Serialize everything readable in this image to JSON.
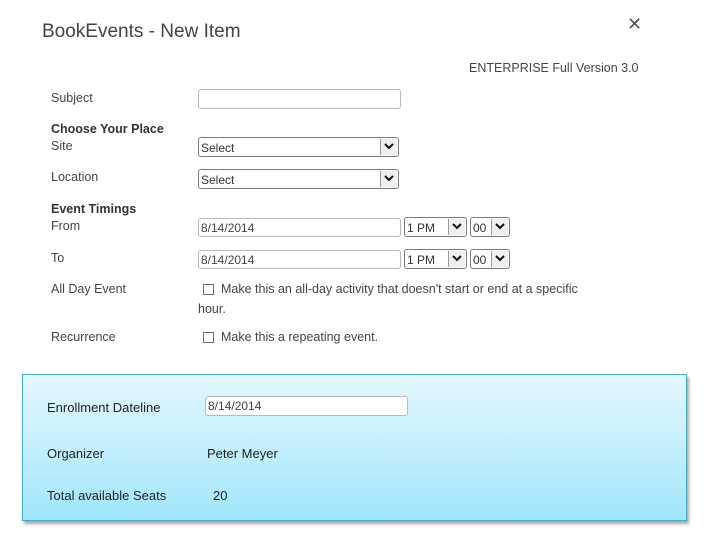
{
  "dialog": {
    "title": "BookEvents - New Item",
    "close_icon": "close-icon",
    "version_label": "ENTERPRISE Full Version 3.0"
  },
  "form": {
    "subject": {
      "label": "Subject",
      "value": ""
    },
    "place_section": "Choose Your Place",
    "site": {
      "label": "Site",
      "value": "Select"
    },
    "location": {
      "label": "Location",
      "value": "Select"
    },
    "timings_section": "Event Timings",
    "from": {
      "label": "From",
      "date": "8/14/2014",
      "hour": "1 PM",
      "minute": "00"
    },
    "to": {
      "label": "To",
      "date": "8/14/2014",
      "hour": "1 PM",
      "minute": "00"
    },
    "all_day": {
      "label": "All Day Event",
      "text_line1": "Make this an all-day activity that doesn't start or end at a specific",
      "text_line2": "hour.",
      "checked": false
    },
    "recurrence": {
      "label": "Recurrence",
      "text": "Make this a repeating event.",
      "checked": false
    }
  },
  "panel": {
    "enrollment": {
      "label": "Enrollment Dateline",
      "value": "8/14/2014"
    },
    "organizer": {
      "label": "Organizer",
      "value": "Peter Meyer"
    },
    "seats": {
      "label": "Total available Seats",
      "value": "20"
    }
  },
  "colors": {
    "panel_border": "#4aaac2",
    "panel_top": "#e4f8fe",
    "panel_bottom": "#9fe6fb"
  }
}
